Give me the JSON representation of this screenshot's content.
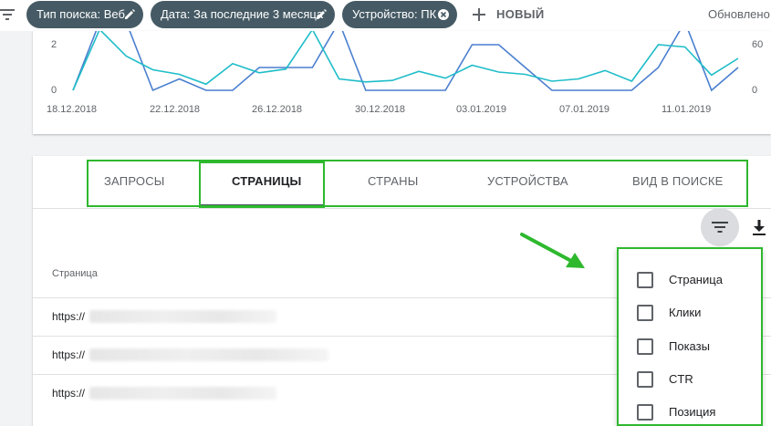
{
  "filters": {
    "chips": [
      {
        "label": "Тип поиска: Веб",
        "action": "edit"
      },
      {
        "label": "Дата: За последние 3 месяца",
        "action": "edit"
      },
      {
        "label": "Устройство: ПК",
        "action": "remove"
      }
    ],
    "new_label": "НОВЫЙ",
    "updated_label": "Обновлено"
  },
  "chart_data": {
    "type": "line",
    "x": [
      "18.12.2018",
      "19.12.2018",
      "20.12.2018",
      "21.12.2018",
      "22.12.2018",
      "23.12.2018",
      "24.12.2018",
      "25.12.2018",
      "26.12.2018",
      "27.12.2018",
      "28.12.2018",
      "29.12.2018",
      "30.12.2018",
      "31.12.2018",
      "01.01.2019",
      "02.01.2019",
      "03.01.2019",
      "04.01.2019",
      "05.01.2019",
      "06.01.2019",
      "07.01.2019",
      "08.01.2019",
      "09.01.2019",
      "10.01.2019",
      "11.01.2019",
      "12.01.2019"
    ],
    "xtick_labels": [
      "18.12.2018",
      "22.12.2018",
      "26.12.2018",
      "30.12.2018",
      "03.01.2019",
      "07.01.2019",
      "11.01.2019"
    ],
    "left_axis": {
      "ticks": [
        "2",
        "0"
      ],
      "range": [
        0,
        2
      ]
    },
    "right_axis": {
      "ticks": [
        "60",
        "0"
      ],
      "range": [
        0,
        60
      ]
    },
    "series": [
      {
        "axis": "left",
        "color": "#4a7fcf",
        "values": [
          0,
          3,
          3,
          0,
          0.5,
          0,
          0,
          1,
          1,
          1,
          3,
          0,
          0,
          0,
          0,
          2,
          2,
          1,
          0,
          0,
          0,
          0,
          1,
          3,
          0,
          1
        ]
      },
      {
        "axis": "right",
        "color": "#1fbdc9",
        "values": [
          0,
          80,
          45,
          27,
          21,
          8,
          35,
          23,
          28,
          80,
          15,
          11,
          13,
          25,
          16,
          33,
          24,
          21,
          12,
          15,
          26,
          12,
          60,
          57,
          20,
          42
        ]
      }
    ]
  },
  "tabs": [
    {
      "label": "ЗАПРОСЫ"
    },
    {
      "label": "СТРАНИЦЫ",
      "active": true
    },
    {
      "label": "СТРАНЫ"
    },
    {
      "label": "УСТРОЙСТВА"
    },
    {
      "label": "ВИД В ПОИСКЕ"
    }
  ],
  "table": {
    "column_header": "Страница",
    "rows": [
      {
        "url": "https://"
      },
      {
        "url": "https://"
      },
      {
        "url": "https://"
      }
    ]
  },
  "column_panel": {
    "options": [
      {
        "label": "Страница",
        "checked": false
      },
      {
        "label": "Клики",
        "checked": false
      },
      {
        "label": "Показы",
        "checked": false
      },
      {
        "label": "CTR",
        "checked": false
      },
      {
        "label": "Позиция",
        "checked": false
      }
    ]
  },
  "colors": {
    "chip_bg": "#455a64",
    "highlight": "#2eb82e",
    "series_blue": "#4a7fcf",
    "series_teal": "#1fbdc9"
  }
}
